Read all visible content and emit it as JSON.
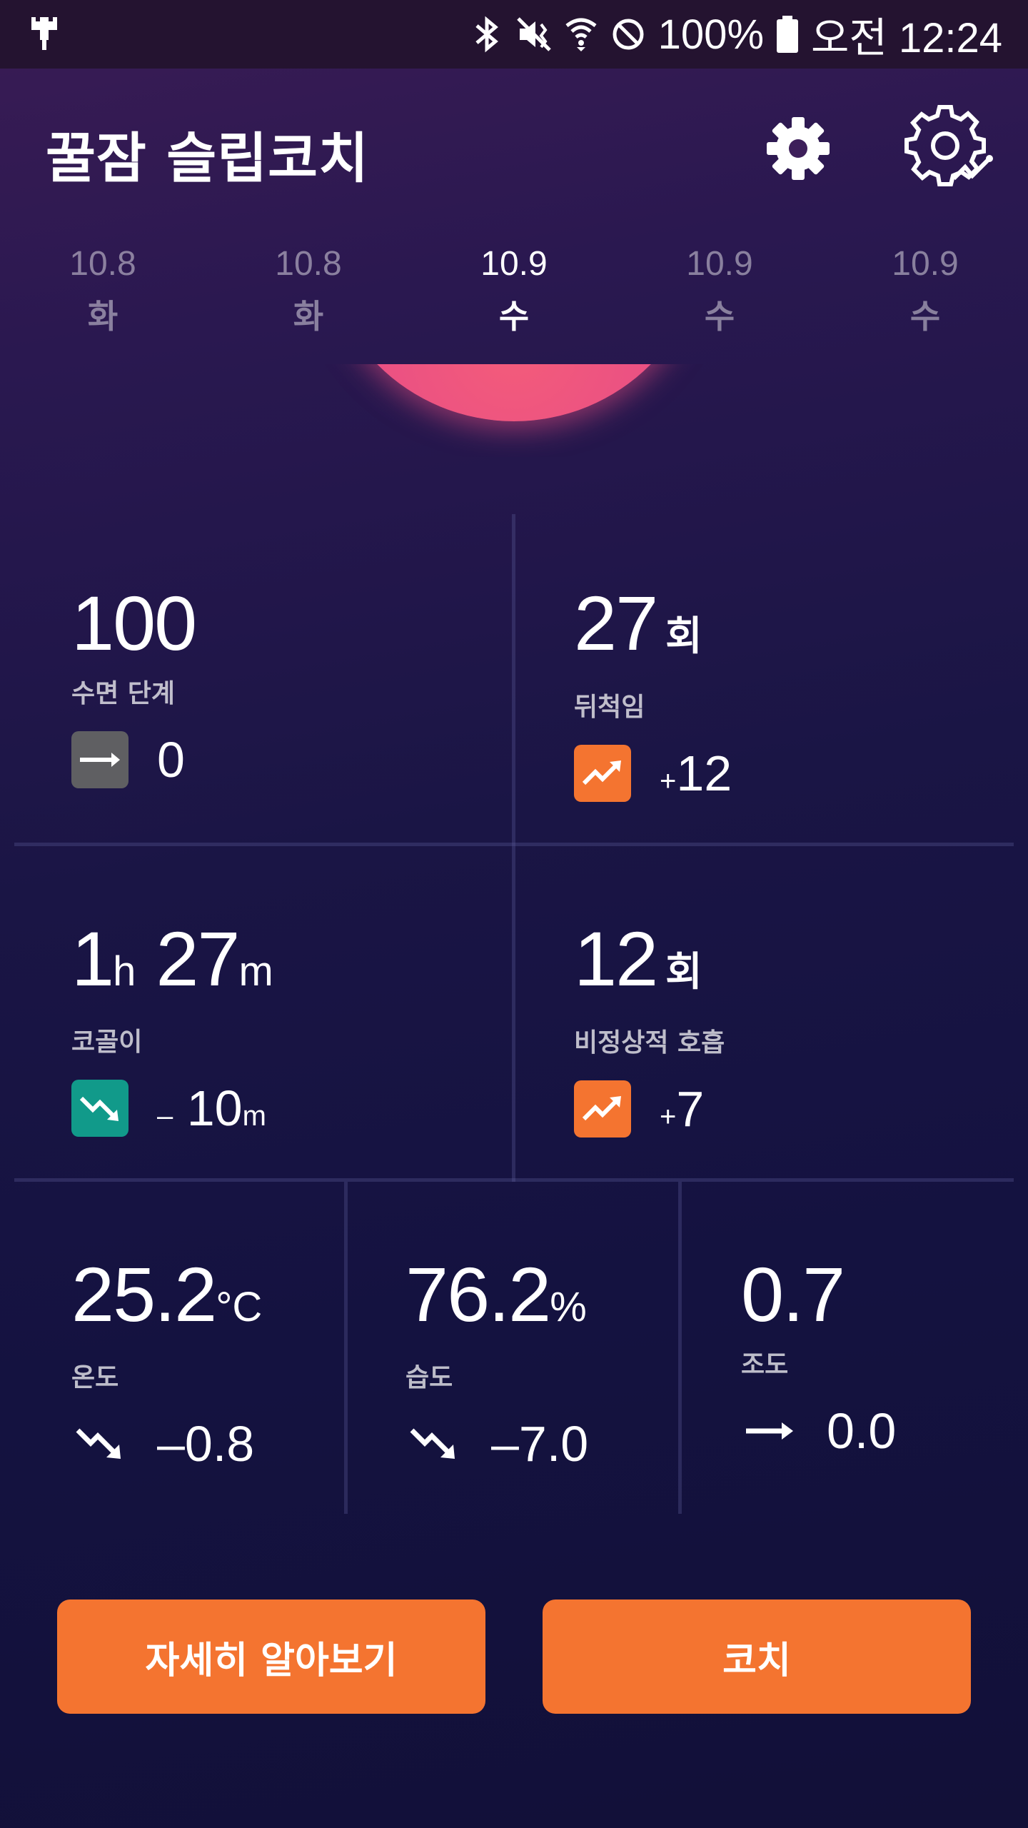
{
  "status_bar": {
    "battery_text": "100%",
    "time": "오전 12:24",
    "icons": [
      "bluetooth-icon",
      "mute-vibrate-icon",
      "wifi-icon",
      "do-not-disturb-icon",
      "battery-icon"
    ]
  },
  "app": {
    "title": "꿀잠 슬립코치"
  },
  "dates": [
    {
      "date": "10.8",
      "day": "화"
    },
    {
      "date": "10.8",
      "day": "화"
    },
    {
      "date": "10.9",
      "day": "수"
    },
    {
      "date": "10.9",
      "day": "수"
    },
    {
      "date": "10.9",
      "day": "수"
    }
  ],
  "metrics": {
    "sleep_stage": {
      "value": "100",
      "label": "수면 단계",
      "delta": "0",
      "trend": "flat"
    },
    "tossing": {
      "value": "27",
      "unit": "회",
      "label": "뒤척임",
      "delta_sign": "+",
      "delta": "12",
      "trend": "up"
    },
    "snoring": {
      "hours": "1",
      "h_unit": "h",
      "minutes": "27",
      "m_unit": "m",
      "label": "코골이",
      "delta_sign": "–",
      "delta": "10",
      "delta_unit": "m",
      "trend": "down"
    },
    "abnormal_breathing": {
      "value": "12",
      "unit": "회",
      "label": "비정상적 호흡",
      "delta_sign": "+",
      "delta": "7",
      "trend": "up"
    },
    "temperature": {
      "value": "25.2",
      "unit": "°C",
      "label": "온도",
      "delta": "–0.8",
      "trend": "down"
    },
    "humidity": {
      "value": "76.2",
      "unit": "%",
      "label": "습도",
      "delta": "–7.0",
      "trend": "down"
    },
    "illuminance": {
      "value": "0.7",
      "label": "조도",
      "delta": "0.0",
      "trend": "flat"
    }
  },
  "buttons": {
    "details": "자세히 알아보기",
    "coach": "코치"
  },
  "colors": {
    "accent": "#f47430",
    "teal": "#119a8a",
    "gray": "#5f5f62",
    "arc": "#e74d86"
  }
}
